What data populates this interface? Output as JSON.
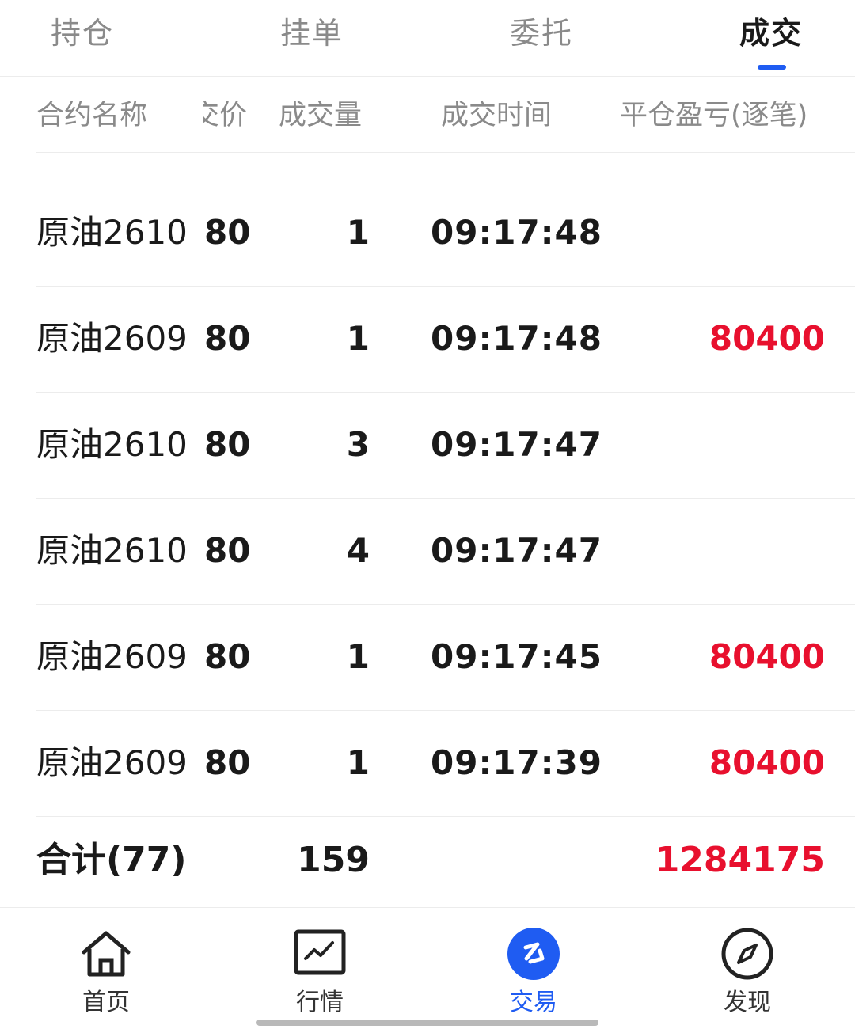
{
  "tabs": [
    {
      "label": "持仓",
      "active": false
    },
    {
      "label": "挂单",
      "active": false
    },
    {
      "label": "委托",
      "active": false
    },
    {
      "label": "成交",
      "active": true
    }
  ],
  "columns": {
    "name": "合约名称",
    "price": "成交价",
    "volume": "成交量",
    "time": "成交时间",
    "pnl": "平仓盈亏(逐笔)"
  },
  "rows": [
    {
      "name": "原油2610",
      "price": "80",
      "volume": "1",
      "time": "09:17:48",
      "pnl": ""
    },
    {
      "name": "原油2609",
      "price": "80",
      "volume": "1",
      "time": "09:17:48",
      "pnl": "80400"
    },
    {
      "name": "原油2610",
      "price": "80",
      "volume": "3",
      "time": "09:17:47",
      "pnl": ""
    },
    {
      "name": "原油2610",
      "price": "80",
      "volume": "4",
      "time": "09:17:47",
      "pnl": ""
    },
    {
      "name": "原油2609",
      "price": "80",
      "volume": "1",
      "time": "09:17:45",
      "pnl": "80400"
    },
    {
      "name": "原油2609",
      "price": "80",
      "volume": "1",
      "time": "09:17:39",
      "pnl": "80400"
    }
  ],
  "total": {
    "label": "合计(77)",
    "volume": "159",
    "pnl": "1284175"
  },
  "bottom_nav": [
    {
      "label": "首页",
      "icon": "home-icon",
      "active": false
    },
    {
      "label": "行情",
      "icon": "chart-icon",
      "active": false
    },
    {
      "label": "交易",
      "icon": "trade-icon",
      "active": true
    },
    {
      "label": "发现",
      "icon": "compass-icon",
      "active": false
    }
  ],
  "colors": {
    "accent": "#1f5cf2",
    "profit": "#e8102e",
    "text": "#1a1a1a",
    "muted": "#8a8a8a"
  }
}
